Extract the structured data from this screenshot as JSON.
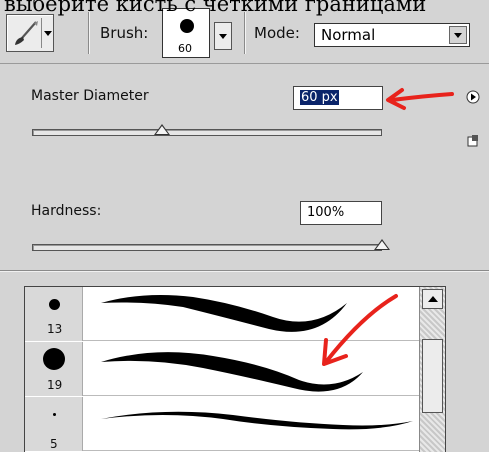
{
  "banner_text": "выберите кисть с четкими границами",
  "toolbar": {
    "tool_preset_icon": "brush-tool-icon",
    "brush_label": "Brush:",
    "brush_size": "60",
    "mode_label": "Mode:",
    "mode_value": "Normal"
  },
  "panel": {
    "master_diameter_label": "Master Diameter",
    "master_diameter_value": "60 px",
    "master_diameter_slider": 0.37,
    "hardness_label": "Hardness:",
    "hardness_value": "100%",
    "hardness_slider": 1.0,
    "menu_icon": "panel-menu-arrow-icon",
    "new_preset_icon": "new-preset-icon"
  },
  "brush_list": [
    {
      "size": "13"
    },
    {
      "size": "19"
    },
    {
      "size": "5"
    }
  ],
  "annotation_color": "#e8231c"
}
